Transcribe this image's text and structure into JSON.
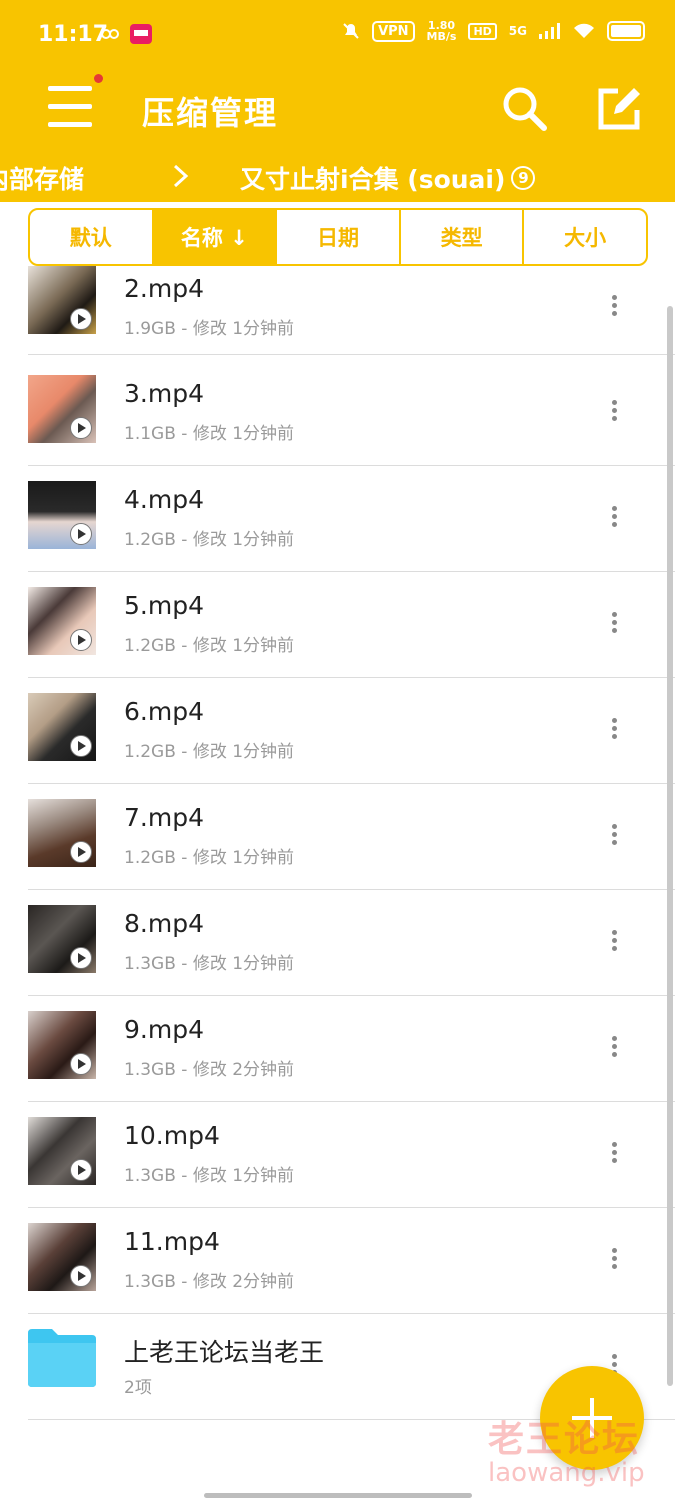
{
  "status": {
    "time": "11:17",
    "vpn": "VPN",
    "speed_value": "1.80",
    "speed_unit": "MB/s",
    "hd": "HD",
    "network": "5G"
  },
  "appbar": {
    "title": "压缩管理"
  },
  "breadcrumb": {
    "parent": "内部存储",
    "current": "又寸止射i合集 (souai)",
    "badge": "9"
  },
  "sort_tabs": [
    {
      "label": "默认",
      "active": false
    },
    {
      "label": "名称 ↓",
      "active": true
    },
    {
      "label": "日期",
      "active": false
    },
    {
      "label": "类型",
      "active": false
    },
    {
      "label": "大小",
      "active": false
    }
  ],
  "files": [
    {
      "name": "2.mp4",
      "meta": "1.9GB - 修改 1分钟前"
    },
    {
      "name": "3.mp4",
      "meta": "1.1GB - 修改 1分钟前"
    },
    {
      "name": "4.mp4",
      "meta": "1.2GB - 修改 1分钟前"
    },
    {
      "name": "5.mp4",
      "meta": "1.2GB - 修改 1分钟前"
    },
    {
      "name": "6.mp4",
      "meta": "1.2GB - 修改 1分钟前"
    },
    {
      "name": "7.mp4",
      "meta": "1.2GB - 修改 1分钟前"
    },
    {
      "name": "8.mp4",
      "meta": "1.3GB - 修改 1分钟前"
    },
    {
      "name": "9.mp4",
      "meta": "1.3GB - 修改 2分钟前"
    },
    {
      "name": "10.mp4",
      "meta": "1.3GB - 修改 1分钟前"
    },
    {
      "name": "11.mp4",
      "meta": "1.3GB - 修改 2分钟前"
    }
  ],
  "folder": {
    "name": "上老王论坛当老王",
    "meta": "2项"
  },
  "watermark": {
    "line1": "老王论坛",
    "line2": "laowang.vip"
  },
  "colors": {
    "accent": "#F8C400",
    "folder": "#3EC6F0"
  }
}
